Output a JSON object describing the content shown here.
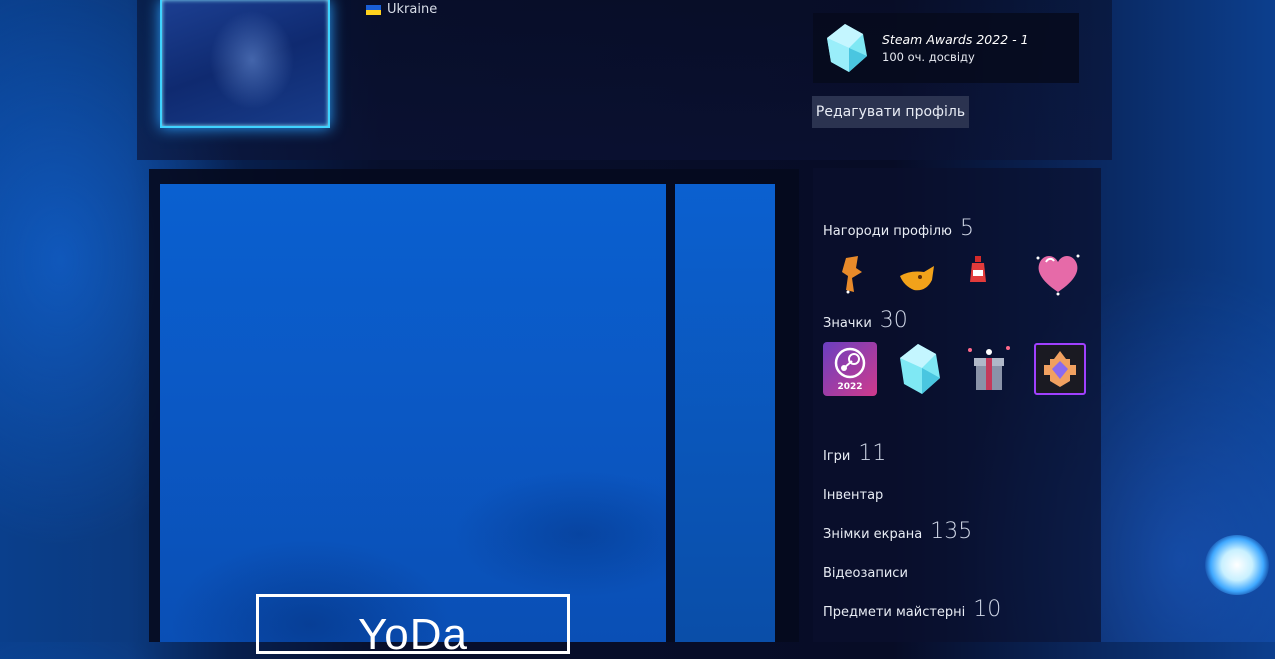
{
  "profile": {
    "country": "Ukraine",
    "flag_icon": "ukraine-flag-icon"
  },
  "award": {
    "title": "Steam Awards 2022 - 1",
    "xp": "100 оч. досвіду",
    "icon": "crystal-icon"
  },
  "edit_profile_label": "Редагувати профіль",
  "showcase": {
    "artwork_text": "YoDa"
  },
  "sidebar": {
    "awards": {
      "label": "Нагороди профілю",
      "count": "5"
    },
    "badges": {
      "label": "Значки",
      "count": "30",
      "steam_badge_year": "2022"
    },
    "games": {
      "label": "Ігри",
      "count": "11"
    },
    "inventory": {
      "label": "Інвентар"
    },
    "screenshots": {
      "label": "Знімки екрана",
      "count": "135"
    },
    "videos": {
      "label": "Відеозаписи"
    },
    "workshop": {
      "label": "Предмети майстерні",
      "count": "10"
    }
  },
  "colors": {
    "accent_frame": "#3fd3ff",
    "button_bg": "#2b3350",
    "artwork_blue": "#0a5bca"
  }
}
